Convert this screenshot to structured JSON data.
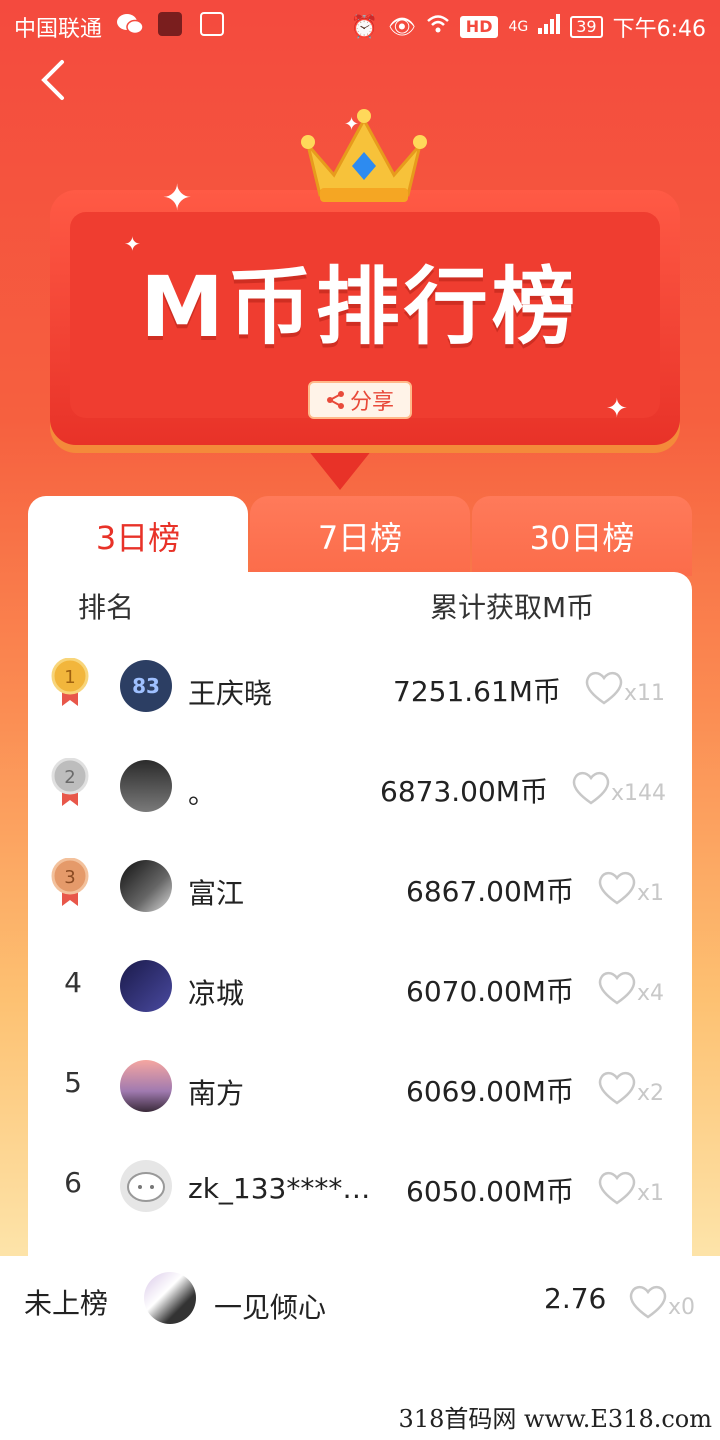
{
  "status_bar": {
    "carrier": "中国联通",
    "network": "4G",
    "hd": "HD",
    "battery": "39",
    "time": "下午6:46"
  },
  "header": {
    "title": "M币排行榜",
    "share_label": "分享"
  },
  "tabs": [
    {
      "label": "3日榜",
      "active": true
    },
    {
      "label": "7日榜",
      "active": false
    },
    {
      "label": "30日榜",
      "active": false
    }
  ],
  "columns": {
    "rank": "排名",
    "coins": "累计获取M币"
  },
  "rows": [
    {
      "rank": "1",
      "name": "王庆晓",
      "coins": "7251.61M币",
      "likes": "x11",
      "avatar_text": "83"
    },
    {
      "rank": "2",
      "name": "。",
      "coins": "6873.00M币",
      "likes": "x144"
    },
    {
      "rank": "3",
      "name": "富江",
      "coins": "6867.00M币",
      "likes": "x1"
    },
    {
      "rank": "4",
      "name": "凉城",
      "coins": "6070.00M币",
      "likes": "x4"
    },
    {
      "rank": "5",
      "name": "南方",
      "coins": "6069.00M币",
      "likes": "x2"
    },
    {
      "rank": "6",
      "name": "zk_133****2…",
      "coins": "6050.00M币",
      "likes": "x1"
    }
  ],
  "me": {
    "rank": "未上榜",
    "name": "一见倾心",
    "coins": "2.76",
    "likes": "x0"
  },
  "watermark": "318首码网  www.E318.com",
  "colors": {
    "accent": "#e83228",
    "gold": "#f2b63c",
    "silver": "#bdbdbd",
    "bronze": "#e59a6a"
  }
}
